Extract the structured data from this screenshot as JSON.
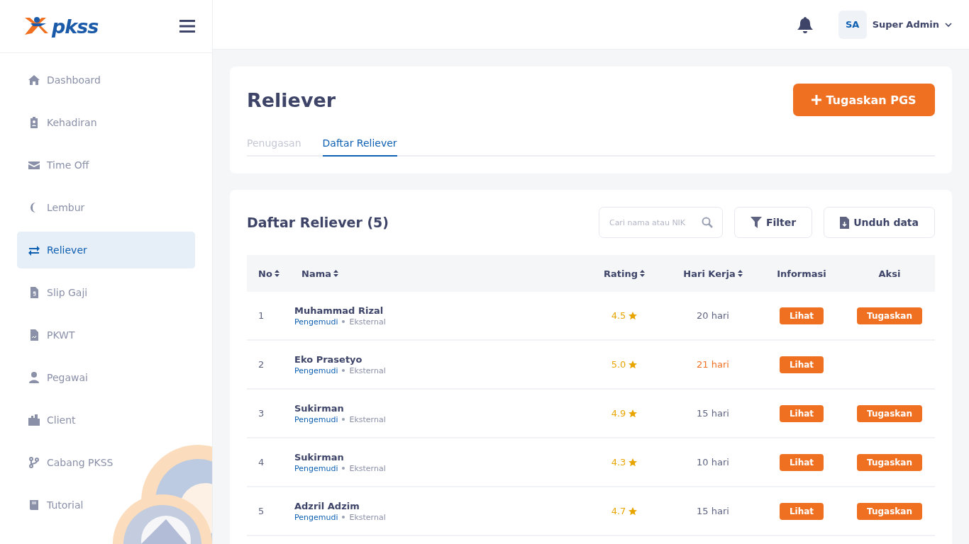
{
  "brand": {
    "logo_text": "pkss"
  },
  "sidebar": {
    "items": [
      {
        "label": "Dashboard",
        "selected": false
      },
      {
        "label": "Kehadiran",
        "selected": false
      },
      {
        "label": "Time Off",
        "selected": false
      },
      {
        "label": "Lembur",
        "selected": false
      },
      {
        "label": "Reliever",
        "selected": true
      },
      {
        "label": "Slip Gaji",
        "selected": false
      },
      {
        "label": "PKWT",
        "selected": false
      },
      {
        "label": "Pegawai",
        "selected": false
      },
      {
        "label": "Client",
        "selected": false
      },
      {
        "label": "Cabang PKSS",
        "selected": false
      },
      {
        "label": "Tutorial",
        "selected": false
      }
    ]
  },
  "header": {
    "user": {
      "initials": "SA",
      "name": "Super Admin"
    }
  },
  "page": {
    "title": "Reliever",
    "primary_button": "Tugaskan PGS",
    "tabs": [
      {
        "label": "Penugasan",
        "selected": false
      },
      {
        "label": "Daftar Reliever",
        "selected": true
      }
    ]
  },
  "list": {
    "title": "Daftar Reliever (5)",
    "search": {
      "placeholder": "Cari nama atau NIK"
    },
    "buttons": [
      "Filter",
      "Unduh data"
    ],
    "table": {
      "columns": [
        {
          "label": "No",
          "sortable": true
        },
        {
          "label": "Nama",
          "sortable": true
        },
        {
          "label": "Rating",
          "sortable": true
        },
        {
          "label": "Hari Kerja",
          "sortable": true
        },
        {
          "label": "Informasi",
          "sortable": false
        },
        {
          "label": "Aksi",
          "sortable": false
        }
      ],
      "rows": [
        {
          "no": "1",
          "name": "Muhammad Rizal",
          "role": "Pengemudi",
          "type": "Eksternal",
          "rating": "4.5",
          "days": "20 hari",
          "days_highlight": false,
          "info_button": "Lihat",
          "action_button": "Tugaskan"
        },
        {
          "no": "2",
          "name": "Eko Prasetyo",
          "role": "Pengemudi",
          "type": "Eksternal",
          "rating": "5.0",
          "days": "21 hari",
          "days_highlight": true,
          "info_button": "Lihat"
        },
        {
          "no": "3",
          "name": "Sukirman",
          "role": "Pengemudi",
          "type": "Eksternal",
          "rating": "4.9",
          "days": "15 hari",
          "days_highlight": false,
          "info_button": "Lihat",
          "action_button": "Tugaskan"
        },
        {
          "no": "4",
          "name": "Sukirman",
          "role": "Pengemudi",
          "type": "Eksternal",
          "rating": "4.3",
          "days": "10 hari",
          "days_highlight": false,
          "info_button": "Lihat",
          "action_button": "Tugaskan"
        },
        {
          "no": "5",
          "name": "Adzril Adzim",
          "role": "Pengemudi",
          "type": "Eksternal",
          "rating": "4.7",
          "days": "15 hari",
          "days_highlight": false,
          "info_button": "Lihat",
          "action_button": "Tugaskan"
        }
      ]
    }
  }
}
